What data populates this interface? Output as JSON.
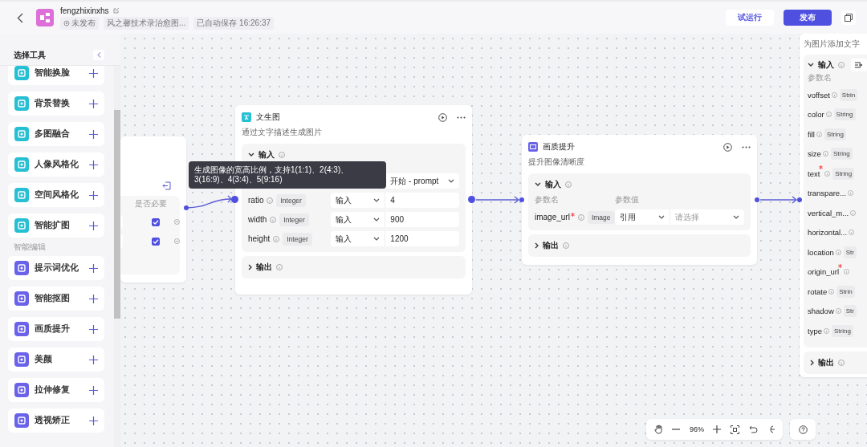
{
  "header": {
    "title": "fengzhixinxhs",
    "tags": [
      {
        "kind": "status",
        "text": "未发布"
      },
      {
        "kind": "plain",
        "text": "风之馨技术录治愈图..."
      },
      {
        "kind": "plain",
        "text": "已自动保存 16:26:37"
      }
    ],
    "buttons": [
      {
        "kind": "outline",
        "label": "试运行"
      },
      {
        "kind": "primary",
        "label": "发布"
      }
    ]
  },
  "sidebar": {
    "title": "选择工具",
    "groups": [
      {
        "kind": "ai",
        "items": [
          "智能换脸",
          "背景替换",
          "多图融合",
          "人像风格化",
          "空间风格化",
          "智能扩图"
        ]
      },
      {
        "kind": "edit",
        "label": "智能编辑",
        "items": [
          "提示词优化",
          "智能抠图",
          "画质提升",
          "美颜",
          "拉伸修复",
          "透视矫正"
        ]
      }
    ]
  },
  "left_node": {
    "column": "是否必要",
    "rows": [
      {
        "required": true
      },
      {
        "required": true
      }
    ]
  },
  "tooltip": "生成图像的宽高比例，支持1(1:1)、2(4:3)、3(16:9)、4(3:4)、5(9:16)",
  "text_node": {
    "title": "文生图",
    "description": "通过文字描述生成图片",
    "input_label": "输入",
    "output_label": "输出",
    "params": [
      {
        "kind": "select",
        "value": "开始 - prompt"
      },
      {
        "kind": "text",
        "name": "ratio",
        "type": "Integer",
        "source": "输入",
        "value": "4"
      },
      {
        "kind": "text",
        "name": "width",
        "type": "Integer",
        "source": "输入",
        "value": "900"
      },
      {
        "kind": "text",
        "name": "height",
        "type": "Integer",
        "source": "输入",
        "value": "1200"
      }
    ]
  },
  "quality_node": {
    "title": "画质提升",
    "description": "提升图像清晰度",
    "input_label": "输入",
    "output_label": "输出",
    "name_header": "参数名",
    "value_header": "参数值",
    "params": [
      {
        "kind": "select",
        "name": "image_url",
        "required": true,
        "type": "Image",
        "source": "引用",
        "placeholder": "请选择"
      }
    ]
  },
  "text_overlay_node": {
    "description": "为图片添加文字",
    "input_label": "输入",
    "output_label": "输出",
    "name_header": "参数名",
    "params": [
      {
        "name": "voffset",
        "required": false,
        "type": "Strin"
      },
      {
        "name": "color",
        "required": false,
        "type": "String"
      },
      {
        "name": "fill",
        "required": false,
        "type": "String"
      },
      {
        "name": "size",
        "required": false,
        "type": "String"
      },
      {
        "name": "text",
        "required": true,
        "type": "String"
      },
      {
        "name": "transpare...",
        "required": false
      },
      {
        "name": "vertical_m...",
        "required": false
      },
      {
        "name": "horizontal...",
        "required": false
      },
      {
        "name": "location",
        "required": false,
        "type": "Str"
      },
      {
        "name": "origin_url",
        "required": true
      },
      {
        "name": "rotate",
        "required": false,
        "type": "Strin"
      },
      {
        "name": "shadow",
        "required": false,
        "type": "Str"
      },
      {
        "name": "type",
        "required": false,
        "type": "String"
      }
    ]
  },
  "toolbar": {
    "zoom": "96%"
  }
}
